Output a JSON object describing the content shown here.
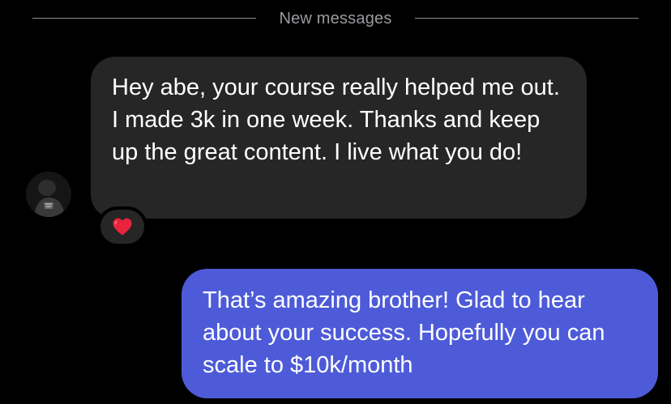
{
  "divider": {
    "label": "New messages"
  },
  "messages": [
    {
      "direction": "incoming",
      "sender_avatar": "profile-photo",
      "text": "Hey abe, your course really helped me out. I made 3k in one week. Thanks and keep up the great content. I live what you do!",
      "reaction": "heart-icon"
    },
    {
      "direction": "outgoing",
      "text": "That’s amazing brother! Glad to hear about your success. Hopefully you can scale to $10k/month"
    }
  ],
  "colors": {
    "background": "#000000",
    "incoming_bubble": "#262626",
    "outgoing_bubble": "#4d5bd8",
    "divider_text": "#9a9a9f",
    "reaction_heart": "#e8243c"
  }
}
